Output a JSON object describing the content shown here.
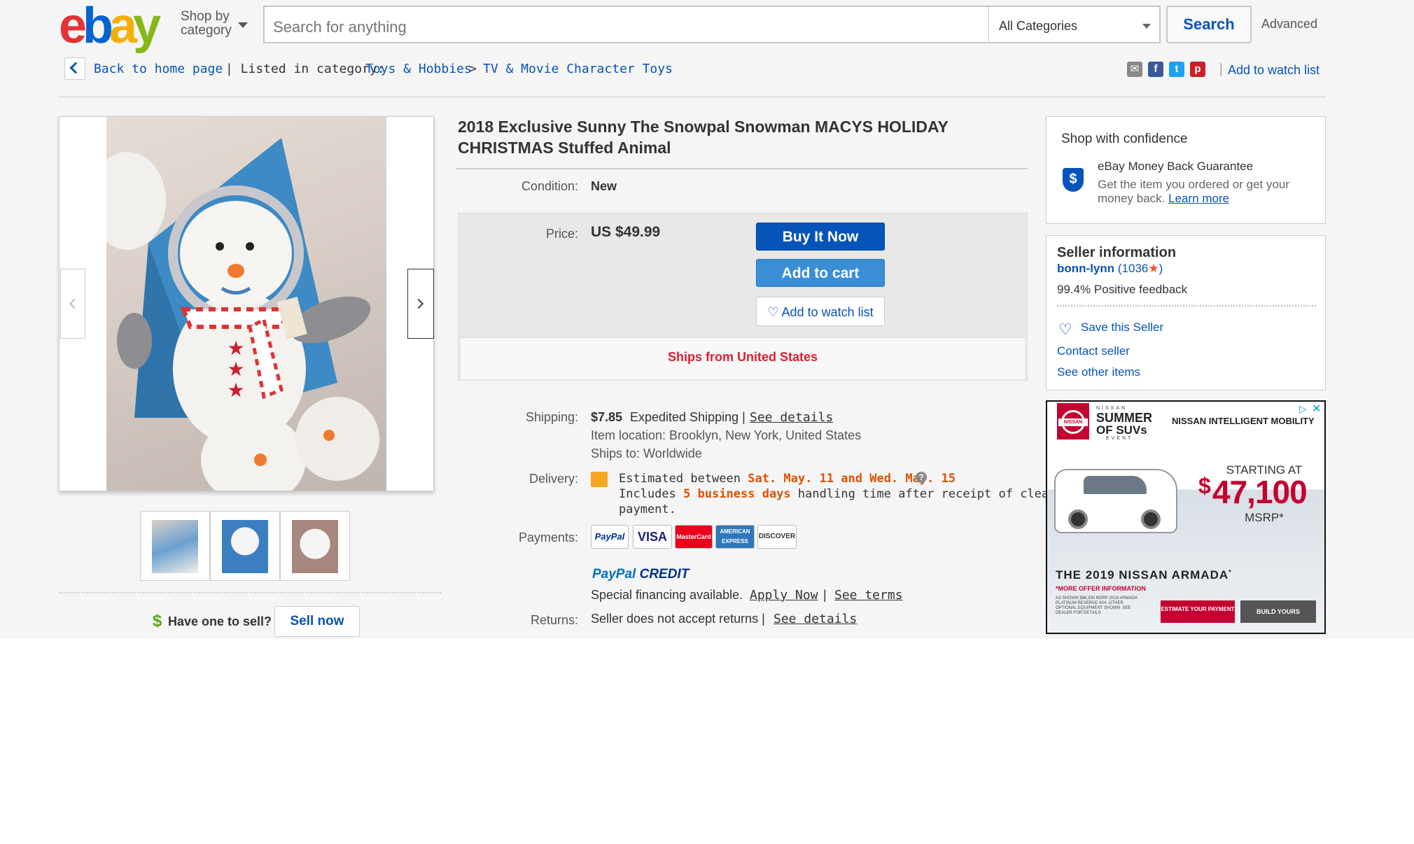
{
  "header": {
    "logo": {
      "e": "e",
      "b": "b",
      "a": "a",
      "y": "y"
    },
    "shop_by_line1": "Shop by",
    "shop_by_line2": "category",
    "search_placeholder": "Search for anything",
    "category_selected": "All Categories",
    "search_button": "Search",
    "advanced_link": "Advanced"
  },
  "breadcrumb": {
    "back_label": "Back to home page",
    "listed_in": "| Listed in category:",
    "cat1": "Toys & Hobbies",
    "sep": ">",
    "cat2": "TV & Movie Character Toys",
    "divider": "|",
    "watch_link": "Add to watch list"
  },
  "share_icons": [
    "email-icon",
    "facebook-icon",
    "twitter-icon",
    "pinterest-icon"
  ],
  "gallery": {
    "main_image": "snowman-plush-photo",
    "thumbnails": [
      "thumbnail-1",
      "thumbnail-2",
      "thumbnail-3"
    ]
  },
  "sell": {
    "dollar": "$",
    "question": "Have one to sell?",
    "button": "Sell now"
  },
  "item": {
    "title": "2018 Exclusive Sunny The Snowpal Snowman MACYS HOLIDAY CHRISTMAS Stuffed Animal",
    "condition_label": "Condition:",
    "condition_value": "New",
    "price_label": "Price:",
    "price_value": "US $49.99",
    "buy_now": "Buy It Now",
    "add_to_cart": "Add to cart",
    "add_to_watch": "Add to watch list",
    "ships_from": "Ships from United States",
    "shipping_label": "Shipping:",
    "shipping_cost": "$7.85",
    "shipping_method": "Expedited Shipping |",
    "shipping_details": "See details",
    "item_location": "Item location:  Brooklyn, New York, United States",
    "ships_to": "Ships to:  Worldwide",
    "delivery_label": "Delivery:",
    "delivery_est_prefix": "Estimated between",
    "delivery_dates": "Sat. May. 11 and Wed. May. 15",
    "delivery_includes": "Includes",
    "delivery_days": "5 business days",
    "delivery_handling": "handling time after receipt of cleared",
    "delivery_payment": "payment.",
    "payments_label": "Payments:",
    "payment_methods": [
      "PayPal",
      "VISA",
      "MasterCard",
      "AMERICAN EXPRESS",
      "DISCOVER"
    ],
    "paypal_credit_pp": "PayPal",
    "paypal_credit_c": "CREDIT",
    "financing_text": "Special financing available.",
    "apply_now": "Apply Now",
    "terms_sep": "|",
    "see_terms": "See terms",
    "returns_label": "Returns:",
    "returns_text": "Seller does not accept returns |",
    "returns_details": "See details"
  },
  "confidence": {
    "title": "Shop with confidence",
    "guarantee_title": "eBay Money Back Guarantee",
    "guarantee_line1": "Get the item you ordered or get your",
    "guarantee_line2": "money back.",
    "learn_more": "Learn more"
  },
  "seller": {
    "title": "Seller information",
    "name": "bonn-lynn",
    "score_open": "(1036",
    "score_close": ")",
    "feedback": "99.4% Positive feedback",
    "save_seller": "Save this Seller",
    "contact": "Contact seller",
    "other_items": "See other items"
  },
  "ad": {
    "nissan_small": "NISSAN",
    "summer": "SUMMER",
    "of_suvs": "OF SUVs",
    "event": "EVENT",
    "brand_tag": "NISSAN INTELLIGENT MOBILITY",
    "starting_at": "STARTING AT",
    "price_dollar": "$",
    "price": "47,100",
    "msrp": "MSRP*",
    "model": "THE 2019 NISSAN ARMADA",
    "more_offer": "*MORE OFFER INFORMATION",
    "fine_print": "AS SHOWN $66,330 MSRP 2019 ARMADA PLATINUM RESERVE 4X4. OTHER OPTIONAL EQUIPMENT SHOWN. SEE DEALER FOR DETAILS",
    "estimate_btn": "ESTIMATE YOUR PAYMENT",
    "build_btn": "BUILD YOURS"
  },
  "colors": {
    "ebay_blue": "#0654ba",
    "buy_button": "#0654ba",
    "cart_button": "#3a8ed6",
    "ships_red": "#dd1e31",
    "delivery_orange": "#dd5200",
    "nissan_red": "#c3002f"
  }
}
